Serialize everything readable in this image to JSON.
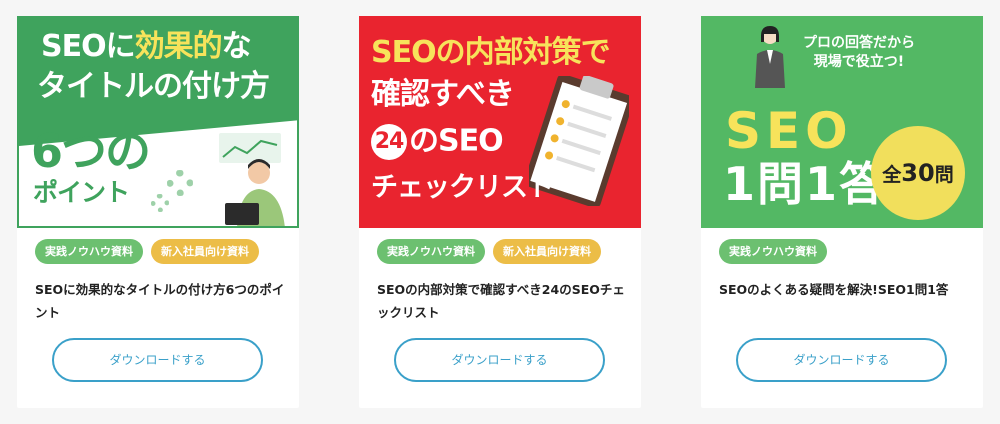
{
  "cards": [
    {
      "thumb": {
        "line1_a": "SEOに",
        "line1_b": "効果的",
        "line1_c": "な",
        "line2": "タイトルの付け方",
        "big": "6つの",
        "sub": "ポイント"
      },
      "tags": [
        "実践ノウハウ資料",
        "新入社員向け資料"
      ],
      "title": "SEOに効果的なタイトルの付け方6つのポイント",
      "button_label": "ダウンロードする"
    },
    {
      "thumb": {
        "line1": "SEOの内部対策で",
        "line2": "確認すべき",
        "num": "24",
        "line3": "のSEO",
        "line4": "チェックリスト"
      },
      "tags": [
        "実践ノウハウ資料",
        "新入社員向け資料"
      ],
      "title": "SEOの内部対策で確認すべき24のSEOチェックリスト",
      "button_label": "ダウンロードする"
    },
    {
      "thumb": {
        "bubble_line1": "プロの回答だから",
        "bubble_line2": "現場で役立つ!",
        "big": "SEO",
        "big2": "1問1答",
        "circle_pre": "全",
        "circle_num": "30",
        "circle_post": "問"
      },
      "tags": [
        "実践ノウハウ資料"
      ],
      "title": "SEOのよくある疑問を解決!SEO1問1答",
      "button_label": "ダウンロードする"
    }
  ],
  "colors": {
    "green": "#3fa35d",
    "red": "#e9242f",
    "yellow": "#f7e35b",
    "tag_green": "#6cc070",
    "tag_yellow": "#ecbd47",
    "button_blue": "#3aa0c9"
  }
}
